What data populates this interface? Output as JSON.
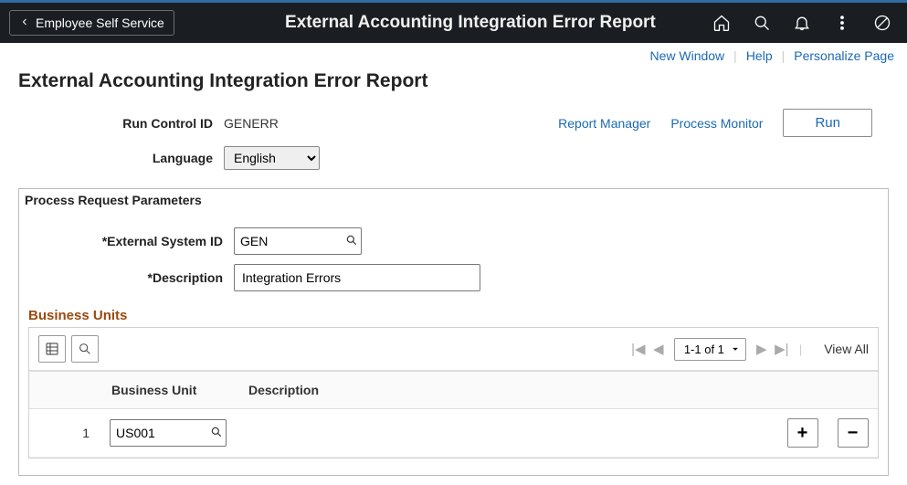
{
  "header": {
    "back_label": "Employee Self Service",
    "title": "External Accounting Integration Error Report"
  },
  "util_links": {
    "new_window": "New Window",
    "help": "Help",
    "personalize": "Personalize Page"
  },
  "page": {
    "title": "External Accounting Integration Error Report"
  },
  "run_control": {
    "label": "Run Control ID",
    "value": "GENERR"
  },
  "language": {
    "label": "Language",
    "selected": "English"
  },
  "actions": {
    "report_manager": "Report Manager",
    "process_monitor": "Process Monitor",
    "run": "Run"
  },
  "params": {
    "legend": "Process Request Parameters",
    "ext_sys_label": "*External System ID",
    "ext_sys_value": "GEN",
    "desc_label": "*Description",
    "desc_value": "Integration Errors"
  },
  "bu": {
    "title": "Business Units",
    "col_bu": "Business Unit",
    "col_desc": "Description",
    "range": "1-1 of 1",
    "view_all": "View All",
    "rows": [
      {
        "num": "1",
        "unit": "US001",
        "desc": ""
      }
    ]
  }
}
